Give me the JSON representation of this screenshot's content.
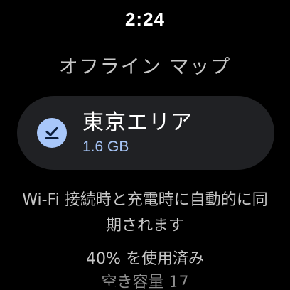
{
  "status_bar": {
    "time": "2:24"
  },
  "header": {
    "title": "オフライン マップ"
  },
  "area_card": {
    "icon": "download-done-icon",
    "name": "東京エリア",
    "size": "1.6 GB",
    "accent_color": "#a8c7fa",
    "card_color": "#202124"
  },
  "info": {
    "sync_text": "Wi-Fi 接続時と充電時に自動的に同期されます",
    "storage_used": "40% を使用済み",
    "storage_free_partial": "空き容量 17"
  }
}
